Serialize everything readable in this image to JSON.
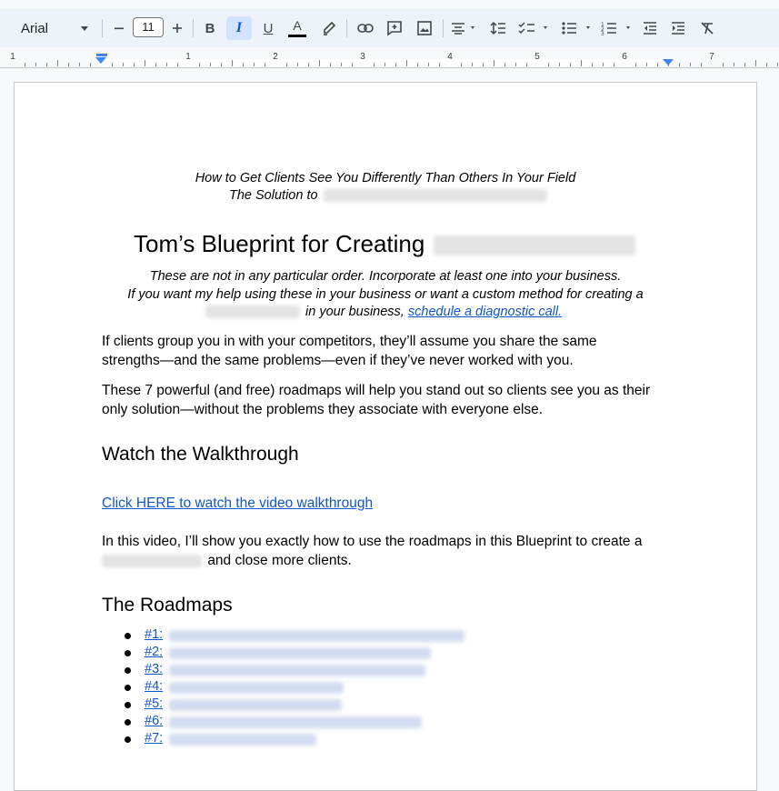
{
  "toolbar": {
    "font": "Arial",
    "font_size": "11",
    "buttons": [
      "decrease-font-size",
      "increase-font-size",
      "bold",
      "italic",
      "underline",
      "text-color",
      "highlight",
      "insert-link",
      "add-comment",
      "insert-image",
      "align",
      "line-spacing",
      "checklist",
      "bulleted-list",
      "numbered-list",
      "decrease-indent",
      "increase-indent",
      "clear-formatting"
    ],
    "active": "italic",
    "bold_label": "B",
    "italic_label": "I",
    "underline_label": "U",
    "text_color_label": "A"
  },
  "ruler": {
    "numbers": [
      "1",
      "1",
      "2",
      "3",
      "4",
      "5",
      "6",
      "7"
    ]
  },
  "document": {
    "subtitle_line1": "How to Get Clients See You Differently Than Others In Your Field",
    "subtitle_line2_prefix": "The Solution to",
    "title_prefix": "Tom’s Blueprint for Creating",
    "intro_line1": "These are not in any particular order.  Incorporate at least one into your business.",
    "intro_line2": "If you want my help using these in your business or want a custom method for creating a",
    "intro_line3_suffix": "in your business,",
    "intro_link": "schedule a diagnostic call.",
    "para1_line1": "If clients group you in with your competitors, they’ll assume you share the same",
    "para1_line2": "strengths—and the same problems—even if they’ve never worked with you.",
    "para2_line1": "These 7 powerful (and free) roadmaps will help you stand out so clients see you as their",
    "para2_line2": "only solution—without the problems they associate with everyone else.",
    "heading_walkthrough": "Watch the Walkthrough",
    "video_link": "Click HERE to watch the video walkthrough",
    "para3_line1": "In this video, I’ll show you exactly how to use the roadmaps in this Blueprint to create a",
    "para3_line2_suffix": "and close more clients.",
    "heading_roadmaps": "The Roadmaps",
    "roadmaps": [
      "#1:",
      "#2:",
      "#3:",
      "#4:",
      "#5:",
      "#6:",
      "#7:"
    ]
  }
}
